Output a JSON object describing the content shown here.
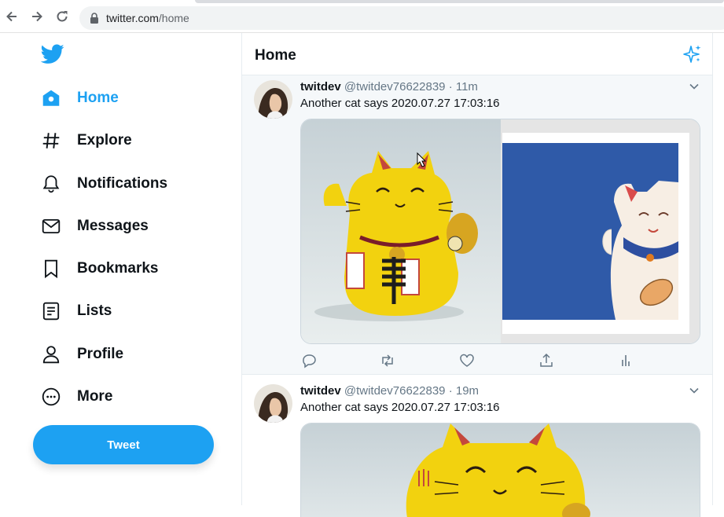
{
  "browser": {
    "url_host": "twitter.com",
    "url_path": "/home"
  },
  "sidebar": {
    "items": [
      {
        "label": "Home",
        "icon": "home-icon"
      },
      {
        "label": "Explore",
        "icon": "hashtag-icon"
      },
      {
        "label": "Notifications",
        "icon": "bell-icon"
      },
      {
        "label": "Messages",
        "icon": "envelope-icon"
      },
      {
        "label": "Bookmarks",
        "icon": "bookmark-icon"
      },
      {
        "label": "Lists",
        "icon": "list-icon"
      },
      {
        "label": "Profile",
        "icon": "person-icon"
      },
      {
        "label": "More",
        "icon": "more-circle-icon"
      }
    ],
    "tweet_button": "Tweet"
  },
  "header": {
    "title": "Home"
  },
  "tweets": [
    {
      "name": "twitdev",
      "handle": "@twitdev76622839",
      "dot": "·",
      "time": "11m",
      "text": "Another cat says 2020.07.27 17:03:16"
    },
    {
      "name": "twitdev",
      "handle": "@twitdev76622839",
      "dot": "·",
      "time": "19m",
      "text": "Another cat says 2020.07.27 17:03:16"
    }
  ],
  "colors": {
    "accent": "#1da1f2",
    "cat_yellow": "#f2d20f",
    "card_blue": "#2f5aa8"
  }
}
